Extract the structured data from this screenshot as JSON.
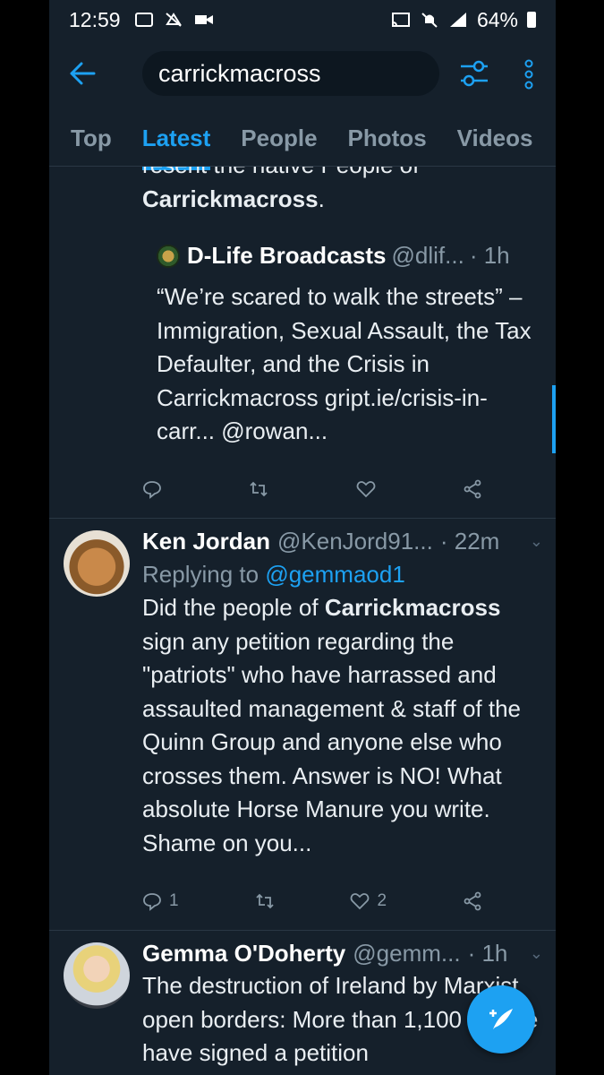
{
  "status_bar": {
    "time": "12:59",
    "battery": "64%"
  },
  "search": {
    "query": "carrickmacross"
  },
  "tabs": [
    {
      "label": "Top"
    },
    {
      "label": "Latest"
    },
    {
      "label": "People"
    },
    {
      "label": "Photos"
    },
    {
      "label": "Videos"
    }
  ],
  "tweet1": {
    "text_top_cut": "resent the native People of",
    "text_bold": "Carrickmacross",
    "text_end": ".",
    "quote": {
      "name": "D-Life Broadcasts",
      "handle": "@dlif...",
      "time": "· 1h",
      "body": "“We’re scared to walk the streets” – Immigration, Sexual Assault, the Tax Defaulter, and the Crisis in Carrickmacross gript.ie/crisis-in-carr...  @rowan..."
    }
  },
  "tweet2": {
    "name": "Ken Jordan",
    "handle": "@KenJord91...",
    "time": "· 22m",
    "replying_label": "Replying to",
    "replying_to": "@gemmaod1",
    "text_pre": "Did the people of",
    "text_bold": "Carrickmacross",
    "text_post": "sign any petition regarding the \"patriots\" who have harrassed and assaulted management & staff of the Quinn Group and anyone else who crosses them. Answer is NO! What absolute Horse Manure you write. Shame on you...",
    "replies": "1",
    "likes": "2"
  },
  "tweet3": {
    "name": "Gemma O'Doherty",
    "handle": "@gemm...",
    "time": "· 1h",
    "text": "The destruction of Ireland by Marxist open borders: More than 1,100 people have signed a petition"
  },
  "icons": {
    "back": "arrow-left-icon",
    "filter": "sliders-icon",
    "more": "more-vertical-icon",
    "compose": "compose-tweet-icon"
  },
  "colors": {
    "background": "#15202b",
    "accent": "#1da1f2",
    "muted": "#8899a6"
  }
}
